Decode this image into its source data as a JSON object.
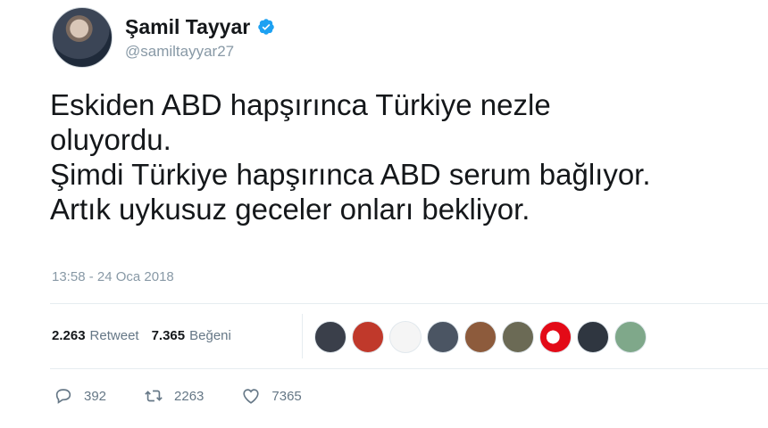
{
  "author": {
    "display_name": "Şamil Tayyar",
    "handle": "@samiltayyar27",
    "verified": true
  },
  "tweet": {
    "lines": [
      "Eskiden ABD hapşırınca Türkiye nezle",
      "oluyordu.",
      "Şimdi Türkiye hapşırınca ABD serum bağlıyor.",
      "Artık uykusuz geceler onları bekliyor."
    ],
    "timestamp": "13:58 - 24 Oca 2018"
  },
  "stats": {
    "retweets_count": "2.263",
    "retweets_label": "Retweet",
    "likes_count": "7.365",
    "likes_label": "Beğeni"
  },
  "likers": [
    {
      "icon": "avatar-dark-photo",
      "color": "#3a3f4a"
    },
    {
      "icon": "avatar-red-emblem",
      "color": "#c0392b"
    },
    {
      "icon": "avatar-turkish-emblem-white",
      "color": "#f5f5f5"
    },
    {
      "icon": "avatar-portrait",
      "color": "#4b5563"
    },
    {
      "icon": "avatar-portrait-warm",
      "color": "#8d5b3c"
    },
    {
      "icon": "avatar-group-photo",
      "color": "#6b6a55"
    },
    {
      "icon": "avatar-turkish-flag",
      "color": "#e30a17"
    },
    {
      "icon": "avatar-portrait-mono",
      "color": "#2f3640"
    },
    {
      "icon": "avatar-green-landscape",
      "color": "#7fa88a"
    }
  ],
  "actions": {
    "reply_count": "392",
    "retweet_count": "2263",
    "like_count": "7365"
  },
  "colors": {
    "verified_blue": "#1da1f2",
    "muted_text": "#657786",
    "flag_red": "#e30a17"
  }
}
